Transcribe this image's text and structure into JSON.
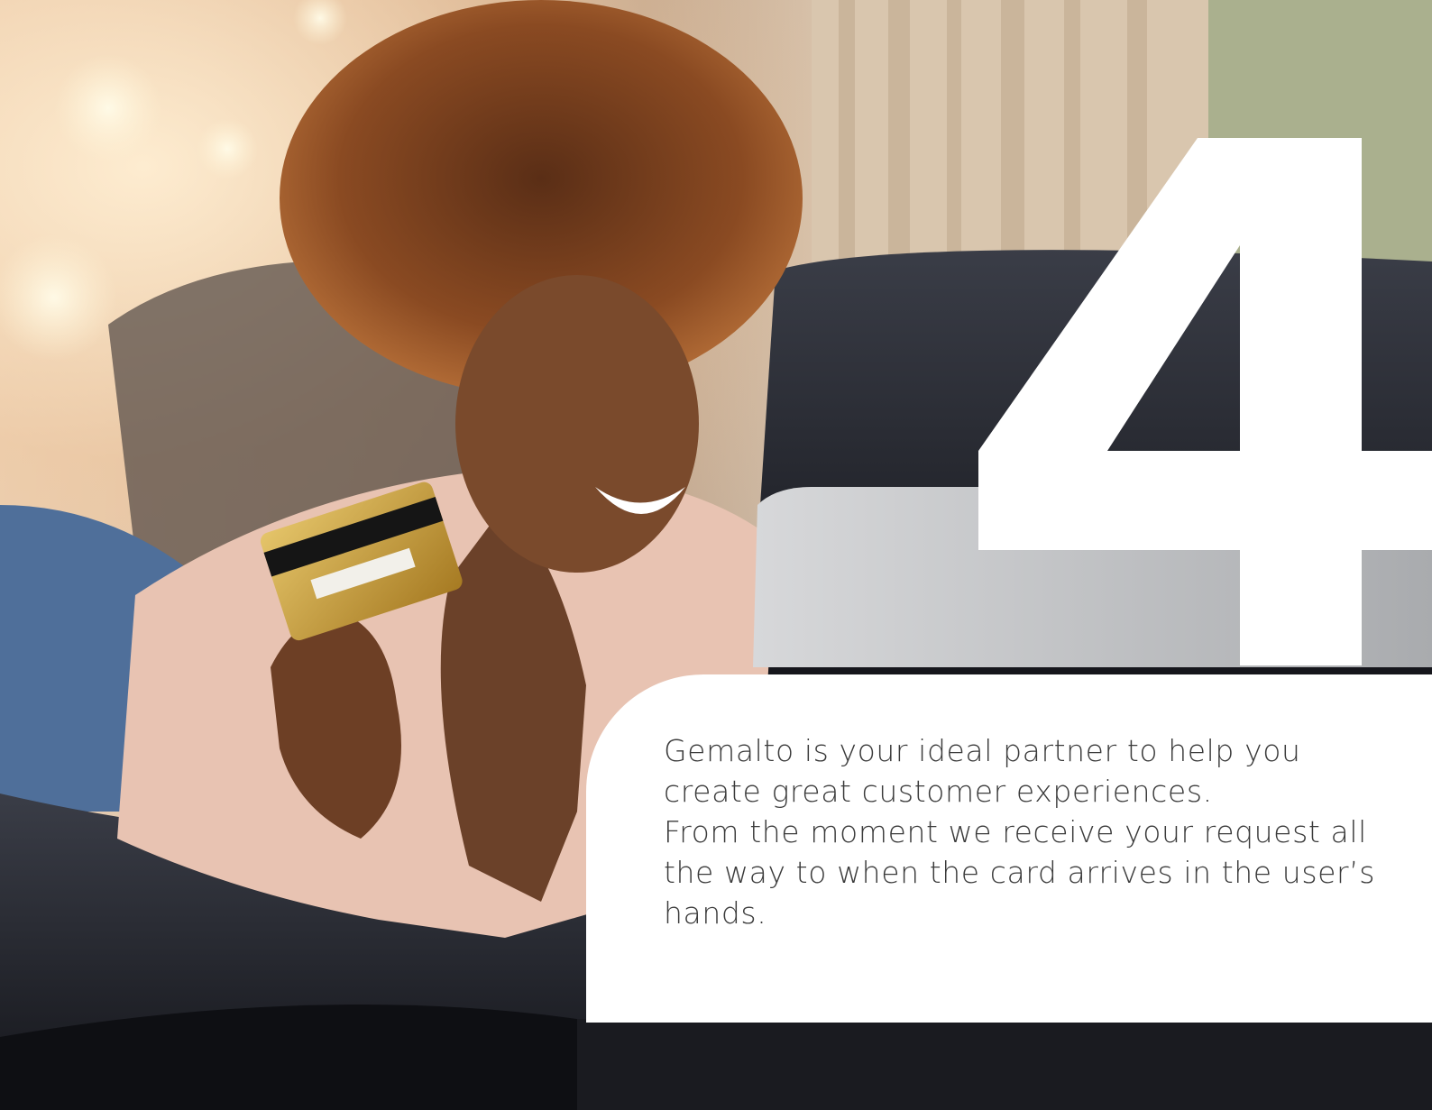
{
  "hero": {
    "numeral": "4",
    "image_alt": "Smiling woman on a leather sofa holding a gold payment card while using a laptop"
  },
  "panel": {
    "lines": [
      "Gemalto is your ideal partner to help you",
      "create great customer experiences.",
      "From the moment we receive your request all",
      "the way to when the card arrives in the user’s",
      "hands."
    ]
  },
  "colors": {
    "panel_bg": "#ffffff",
    "text": "#3b3b3b",
    "card_gold": "#c9a13b",
    "sofa": "#24262d",
    "numeral": "#ffffff"
  }
}
